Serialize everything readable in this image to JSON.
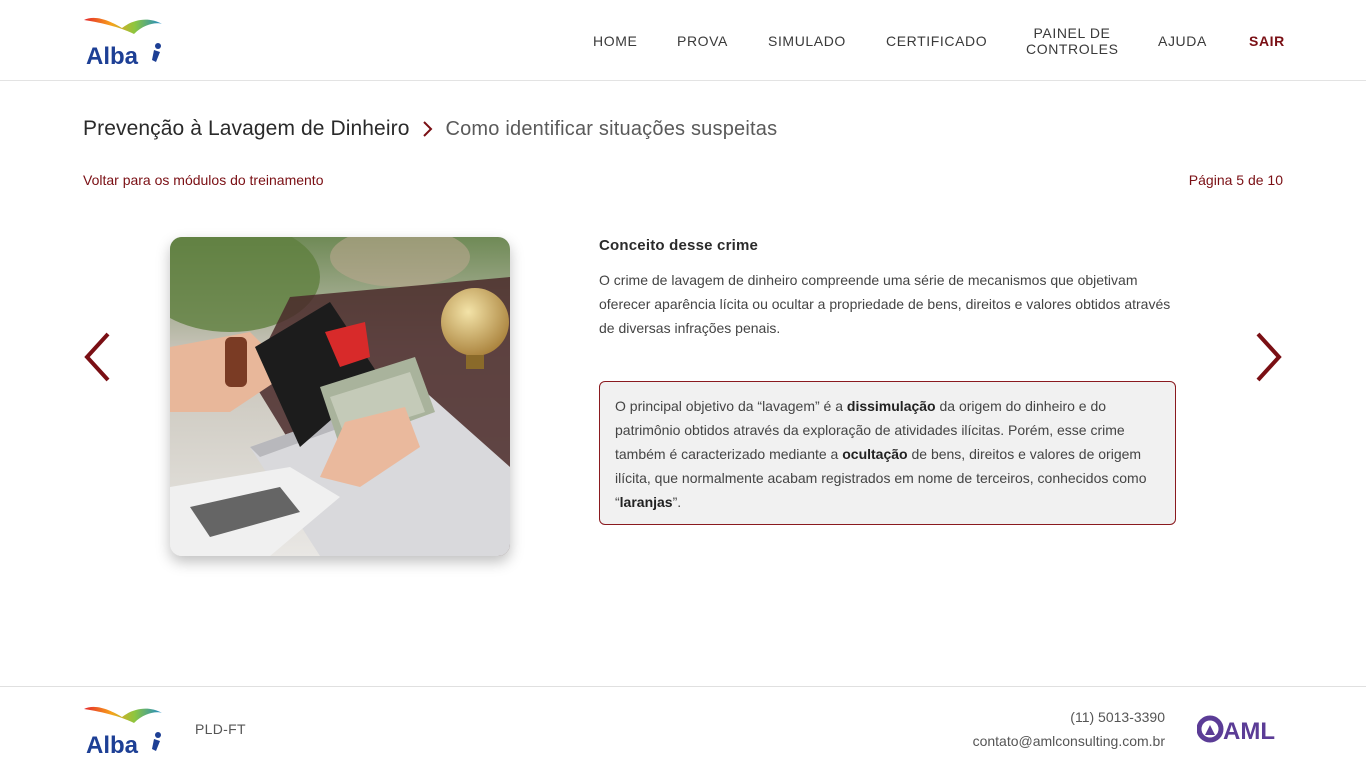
{
  "header": {
    "logo_text": "Alba",
    "nav": {
      "home": "HOME",
      "prova": "PROVA",
      "simulado": "SIMULADO",
      "certificado": "CERTIFICADO",
      "painel_line1": "PAINEL DE",
      "painel_line2": "CONTROLES",
      "ajuda": "AJUDA",
      "sair": "SAIR"
    }
  },
  "breadcrumb": {
    "main": "Prevenção à Lavagem de Dinheiro",
    "sub": "Como identificar situações suspeitas"
  },
  "back_link": "Voltar para os módulos do treinamento",
  "pagination": "Página 5 de 10",
  "content": {
    "title": "Conceito desse crime",
    "text": "O crime de lavagem de dinheiro compreende uma série de mecanismos que objetivam oferecer aparência lícita ou ocultar a propriedade de bens, direitos e valores obtidos através de diversas infrações penais.",
    "highlight": {
      "p1": "O principal objetivo da “lavagem” é a ",
      "b1": "dissimulação",
      "p2": " da origem do dinheiro e do patrimônio obtidos através da exploração de atividades ilícitas. Porém, esse crime também é caracterizado mediante a ",
      "b2": "ocultação",
      "p3": " de bens, direitos e valores de origem ilícita, que normalmente acabam registrados em nome de terceiros, conhecidos como “",
      "b3": "laranjas",
      "p4": "”."
    }
  },
  "footer": {
    "logo_text": "Alba",
    "tag": "PLD-FT",
    "phone": "(11) 5013-3390",
    "email": "contato@amlconsulting.com.br",
    "partner_logo_text": "AML"
  },
  "colors": {
    "accent": "#7a0f14",
    "box_border": "#8a1a1f",
    "box_bg": "#f1f1f1"
  },
  "icons": {
    "breadcrumb_separator": "chevron-right-icon",
    "prev": "chevron-left-icon",
    "next": "chevron-right-icon"
  }
}
